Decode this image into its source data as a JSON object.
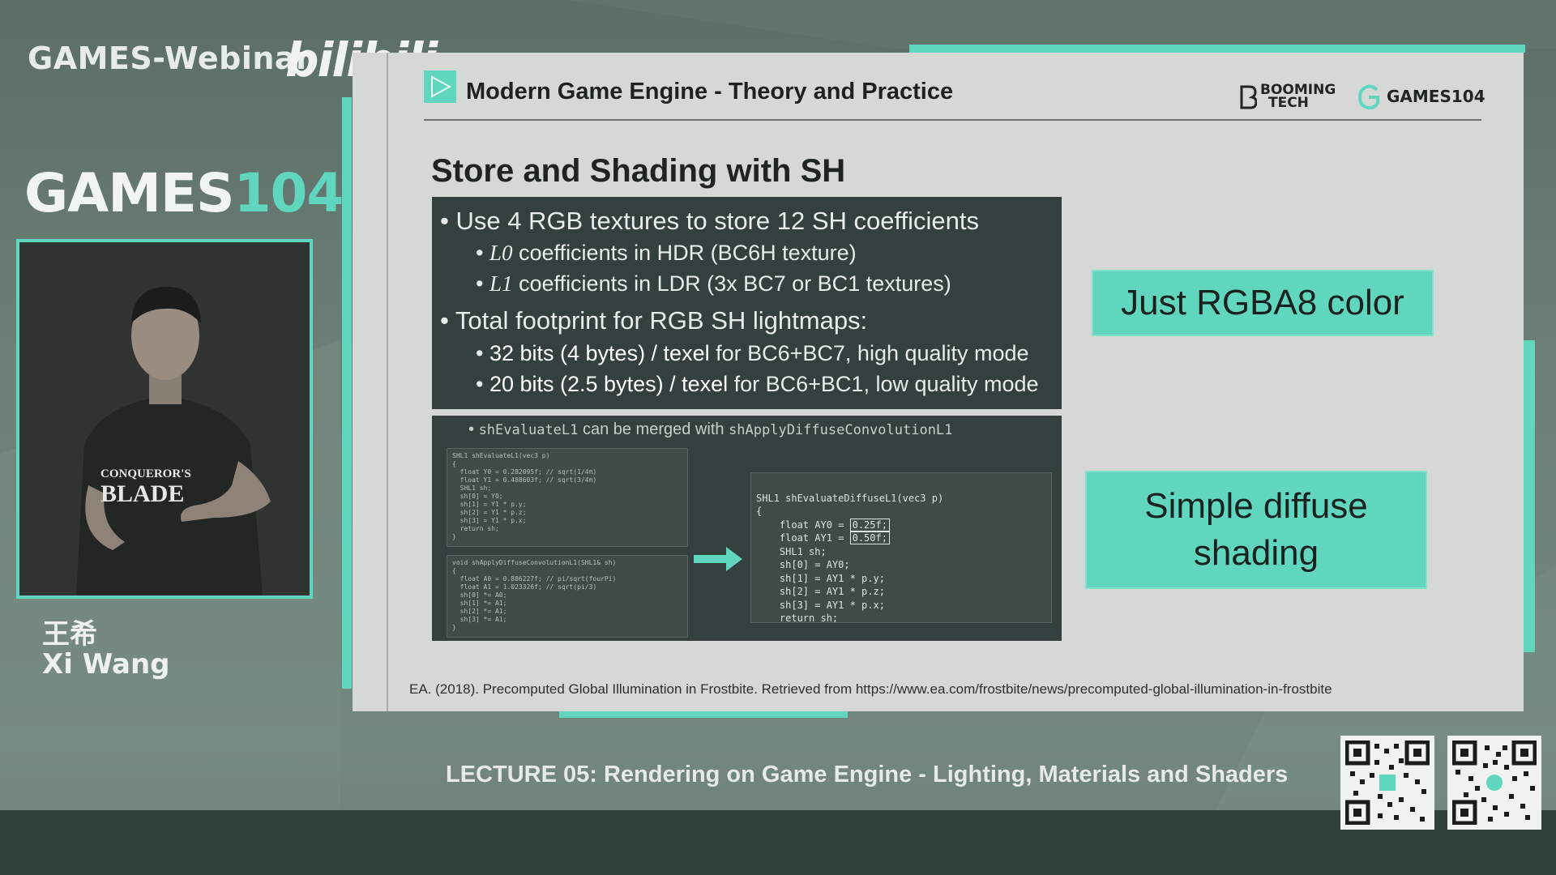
{
  "overlay": {
    "webinar_label": "GAMES-Webinar",
    "bilibili_label": "bilibili",
    "brand_part1": "GAMES",
    "brand_part2": "104",
    "speaker_name_cn": "王希",
    "speaker_name_en": "Xi Wang",
    "shirt_line1": "CONQUEROR'S",
    "shirt_line2": "BLADE",
    "lecture_title": "LECTURE 05: Rendering on Game Engine - Lighting, Materials and Shaders"
  },
  "slide": {
    "course_title": "Modern Game Engine - Theory and Practice",
    "logo_booming_1": "BOOMING",
    "logo_booming_2": "TECH",
    "logo_games": "GAMES104",
    "title": "Store and Shading with SH",
    "bullets": {
      "b1": "• Use 4 RGB textures to store 12 SH coefficients",
      "b1_1_var": "L0",
      "b1_1_text": "coefficients in HDR (BC6H texture)",
      "b1_2_var": "L1",
      "b1_2_text": "coefficients in LDR (3x BC7 or BC1 textures)",
      "b2": "• Total footprint for RGB SH lightmaps:",
      "b2_1_bold": "32 bits (4 bytes) / texel",
      "b2_1_rest": "for BC6+BC7, high quality mode",
      "b2_2_bold": "20 bits (2.5 bytes) / texel",
      "b2_2_rest": "for BC6+BC1, low quality mode"
    },
    "code_note": {
      "fn1": "shEvaluateL1",
      "middle": "can be merged with",
      "fn2": "shApplyDiffuseConvolutionL1"
    },
    "code_left_top": "SHL1 shEvaluateL1(vec3 p)\n{\n  float Y0 = 0.282095f; // sqrt(1/4π)\n  float Y1 = 0.488603f; // sqrt(3/4π)\n  SHL1 sh;\n  sh[0] = Y0;\n  sh[1] = Y1 * p.y;\n  sh[2] = Y1 * p.z;\n  sh[3] = Y1 * p.x;\n  return sh;\n}",
    "code_left_bottom": "void shApplyDiffuseConvolutionL1(SHL1& sh)\n{\n  float A0 = 0.886227f; // pi/sqrt(fourPi)\n  float A1 = 1.023326f; // sqrt(pi/3)\n  sh[0] *= A0;\n  sh[1] *= A1;\n  sh[2] *= A1;\n  sh[3] *= A1;\n}",
    "code_right": {
      "l1": "SHL1 shEvaluateDiffuseL1(vec3 p)",
      "l2": "{",
      "l3a": "    float AY0 = ",
      "l3b": "0.25f;",
      "l4a": "    float AY1 = ",
      "l4b": "0.50f;",
      "l5": "    SHL1 sh;",
      "l6": "    sh[0] = AY0;",
      "l7": "    sh[1] = AY1 * p.y;",
      "l8": "    sh[2] = AY1 * p.z;",
      "l9": "    sh[3] = AY1 * p.x;",
      "l10": "    return sh;",
      "l11": "}"
    },
    "callout_1": "Just RGBA8 color",
    "callout_2_line1": "Simple diffuse",
    "callout_2_line2": "shading",
    "reference": "EA. (2018). Precomputed Global Illumination in Frostbite. Retrieved from https://www.ea.com/frostbite/news/precomputed-global-illumination-in-frostbite"
  },
  "colors": {
    "accent": "#5fd6bd",
    "slide_bg": "#d6d8d5",
    "dark_panel": "#34403d"
  }
}
